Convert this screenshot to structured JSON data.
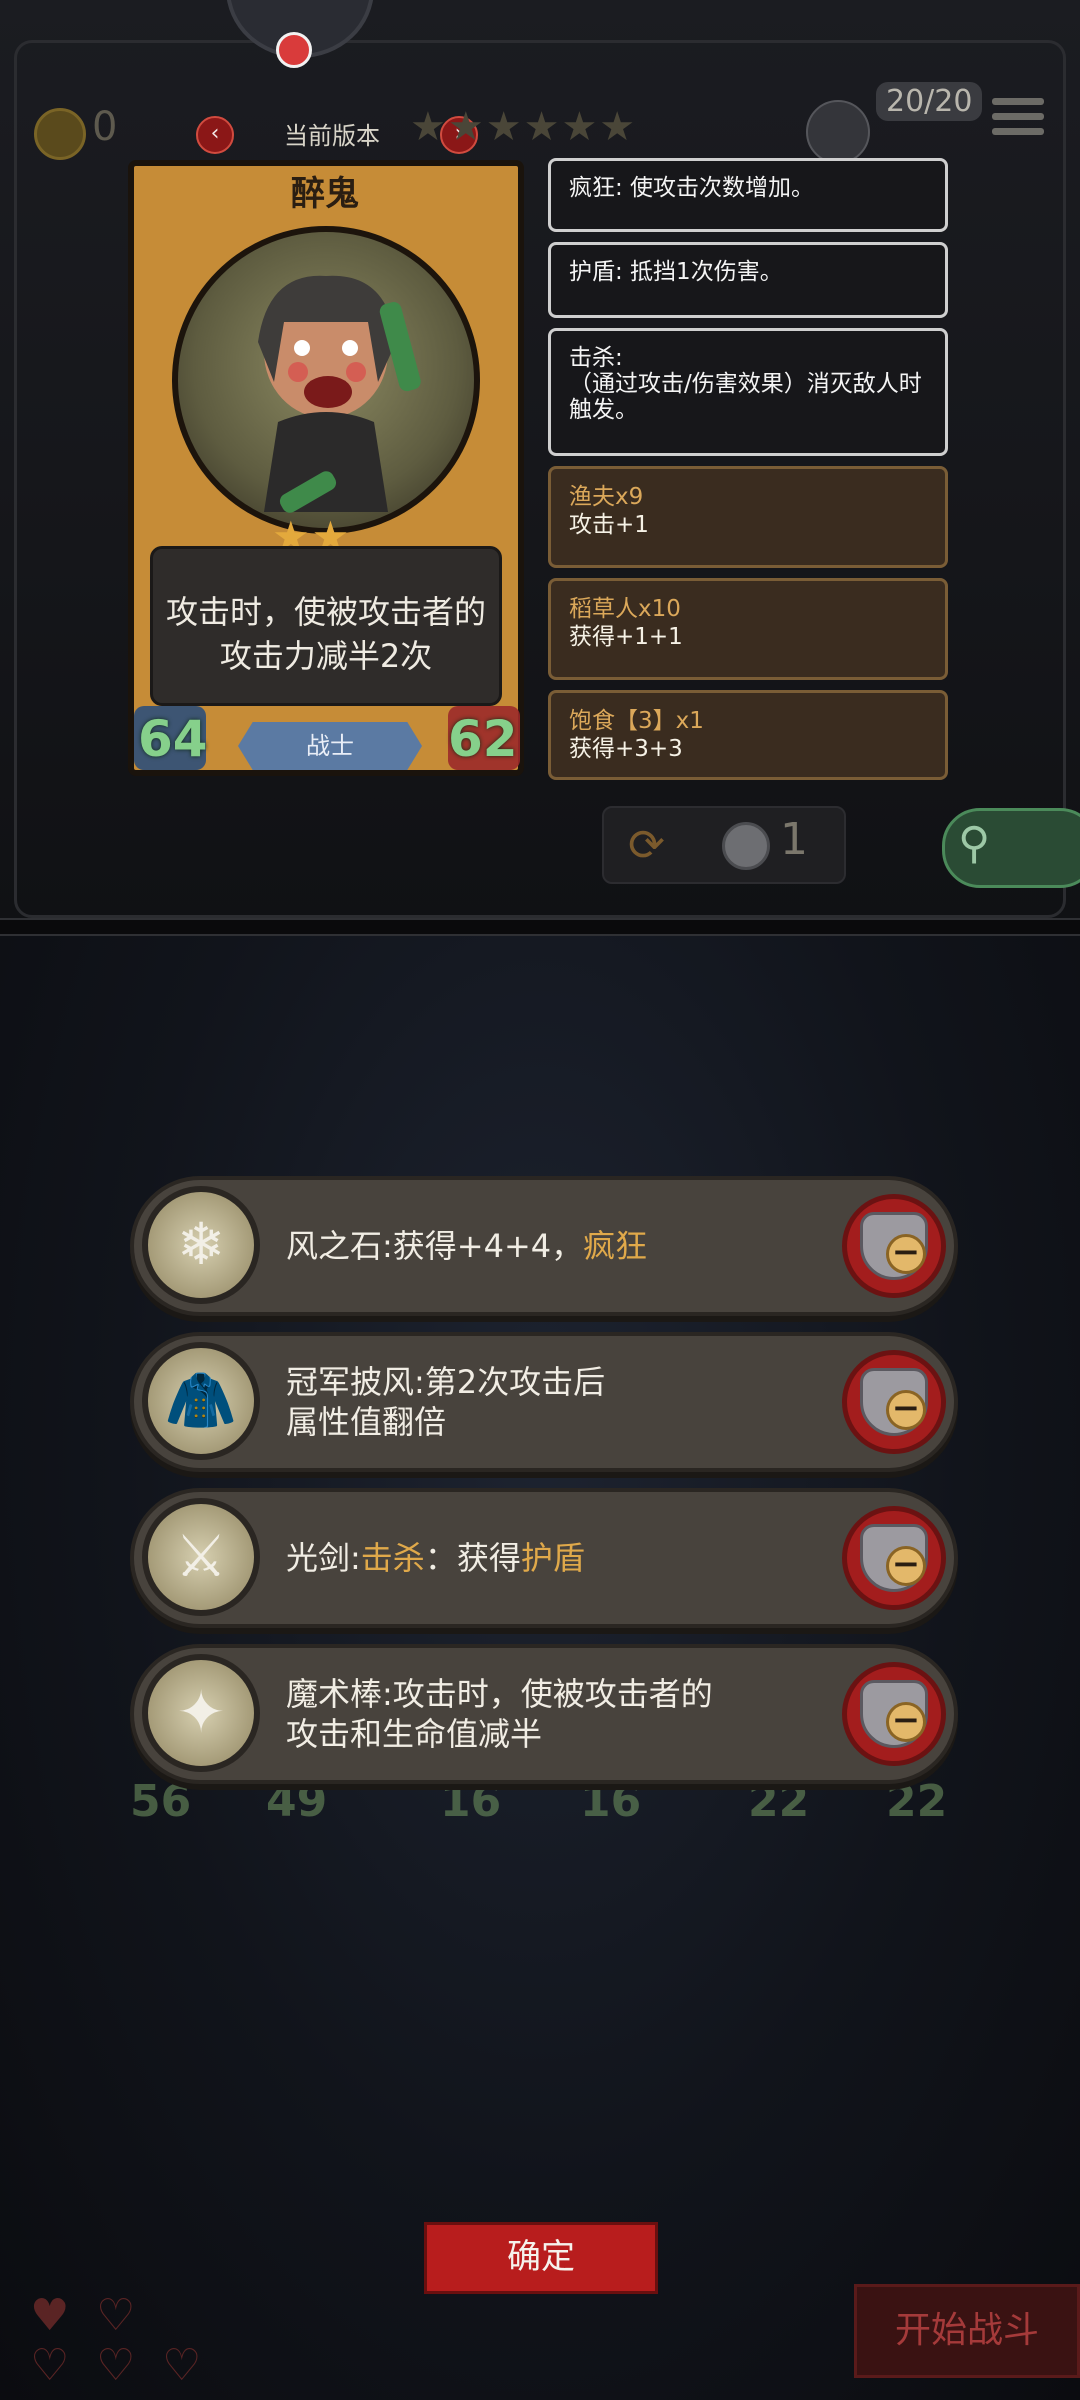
{
  "header": {
    "coins": "0",
    "version_label": "当前版本",
    "stars": "★★★★★★",
    "troops": "20/20",
    "prev_arrow": "‹",
    "next_arrow": "›"
  },
  "hero": {
    "name": "醉鬼",
    "stars": "★★",
    "ability": "攻击时，使被攻击者的攻击力减半2次",
    "attack": "64",
    "health": "62",
    "class": "战士"
  },
  "keywords": [
    {
      "text": "疯狂: 使攻击次数增加。"
    },
    {
      "text": "护盾: 抵挡1次伤害。"
    },
    {
      "text": "击杀:\n（通过攻击/伤害效果）消灭敌人时触发。"
    }
  ],
  "bonuses": [
    {
      "name": "渔夫x9",
      "value": "攻击+1"
    },
    {
      "name": "稻草人x10",
      "value": "获得+1+1"
    },
    {
      "name": "饱食【3】x1",
      "value": "获得+3+3"
    }
  ],
  "toolbar": {
    "refresh_count": "1"
  },
  "items": [
    {
      "icon": "wind-stone-icon",
      "glyph": "❄",
      "prefix": "风之石:获得+4+4，",
      "highlight": "疯狂",
      "suffix": ""
    },
    {
      "icon": "champion-cape-icon",
      "glyph": "🧥",
      "prefix": "冠军披风:第2次攻击后\n属性值翻倍",
      "highlight": "",
      "suffix": ""
    },
    {
      "icon": "light-sword-icon",
      "glyph": "⚔",
      "prefix": "光剑:",
      "highlight": "击杀",
      "mid": "：获得",
      "highlight2": "护盾"
    },
    {
      "icon": "magic-wand-icon",
      "glyph": "✦",
      "prefix": "魔术棒:攻击时，使被攻击者的\n攻击和生命值减半",
      "highlight": "",
      "suffix": ""
    }
  ],
  "background_stats": {
    "a_atk": "56",
    "a_hp": "49",
    "b_atk": "16",
    "b_hp": "16",
    "c_atk": "22",
    "c_hp": "22"
  },
  "buttons": {
    "confirm": "确定",
    "start_battle": "开始战斗"
  },
  "colors": {
    "highlight": "#e0a94a",
    "remove_button": "#a31d1d",
    "stat_green": "#86d08b"
  }
}
